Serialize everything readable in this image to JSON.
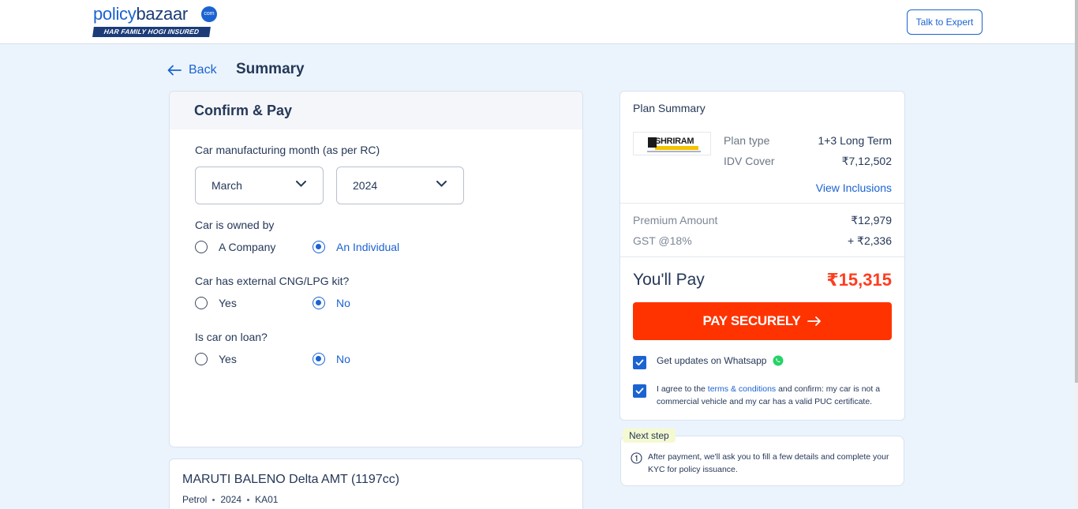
{
  "header": {
    "logo_policy": "policy",
    "logo_bazaar": "bazaar",
    "logo_com": "com",
    "logo_tagline": "HAR FAMILY HOGI INSURED",
    "talk_to_expert": "Talk to Expert"
  },
  "nav": {
    "back_label": "Back",
    "page_title": "Summary"
  },
  "confirm": {
    "title": "Confirm & Pay",
    "mfg_label": "Car manufacturing month (as per RC)",
    "month_value": "March",
    "year_value": "2024",
    "owned_label": "Car is owned by",
    "owned_options": [
      "A Company",
      "An Individual"
    ],
    "owned_selected": "An Individual",
    "cng_label": "Car has external CNG/LPG kit?",
    "cng_options": [
      "Yes",
      "No"
    ],
    "cng_selected": "No",
    "loan_label": "Is car on loan?",
    "loan_options": [
      "Yes",
      "No"
    ],
    "loan_selected": "No"
  },
  "car": {
    "name": "MARUTI BALENO Delta AMT (1197cc)",
    "fuel": "Petrol",
    "year": "2024",
    "rto": "KA01"
  },
  "plan": {
    "title": "Plan Summary",
    "insurer": "SHRIRAM",
    "plan_type_label": "Plan type",
    "plan_type_value": "1+3 Long Term",
    "idv_label": "IDV Cover",
    "idv_value": "₹7,12,502",
    "view_inclusions": "View Inclusions",
    "premium_label": "Premium Amount",
    "premium_value": "₹12,979",
    "gst_label": "GST @18%",
    "gst_value": "+ ₹2,336",
    "you_pay_label": "You'll Pay",
    "you_pay_value": "₹15,315",
    "pay_button": "PAY SECURELY",
    "whatsapp_label": "Get updates on Whatsapp",
    "terms_prefix": "I agree to the ",
    "terms_link": "terms & conditions",
    "terms_suffix": " and confirm: my car is not a commercial vehicle and my car has a valid PUC certificate.",
    "whatsapp_checked": true,
    "terms_checked": true
  },
  "next_step": {
    "badge": "Next step",
    "text": "After payment, we'll ask you to fill a few details and complete your KYC for policy issuance."
  },
  "colors": {
    "brand_blue": "#1b63d1",
    "pay_orange": "#ff3300",
    "page_bg": "#ebf4fd"
  }
}
